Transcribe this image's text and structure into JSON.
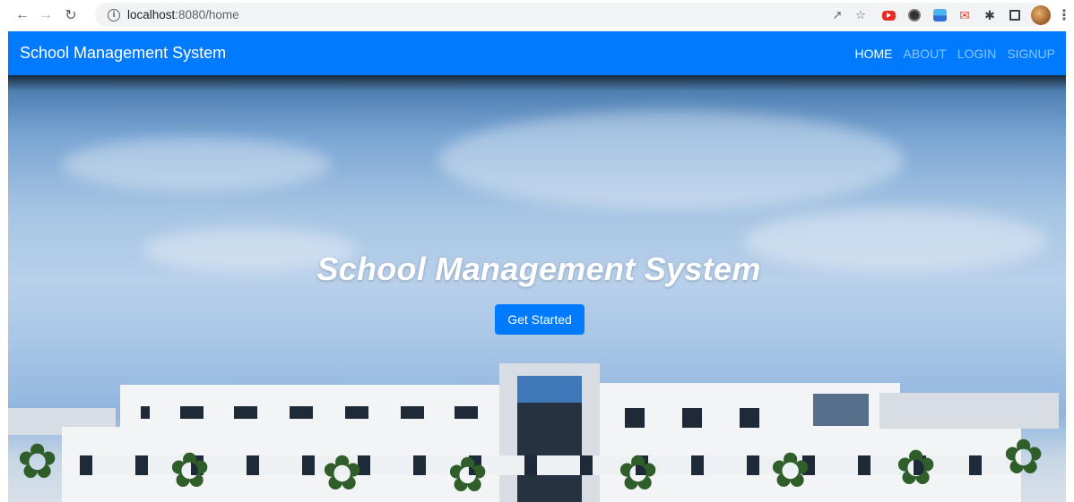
{
  "browser": {
    "url_host": "localhost",
    "url_rest": ":8080/home",
    "icons": [
      "back-arrow-icon",
      "forward-arrow-icon",
      "reload-icon",
      "info-icon",
      "share-icon",
      "star-icon",
      "youtube-extension-icon",
      "circle-extension-icon",
      "drive-extension-icon",
      "megaphone-extension-icon",
      "puzzle-extension-icon",
      "side-panel-icon",
      "profile-avatar",
      "menu-kebab-icon"
    ]
  },
  "navbar": {
    "brand": "School Management System",
    "links": [
      {
        "label": "HOME",
        "active": true
      },
      {
        "label": "ABOUT",
        "active": false
      },
      {
        "label": "LOGIN",
        "active": false
      },
      {
        "label": "SIGNUP",
        "active": false
      }
    ]
  },
  "hero": {
    "title": "School Management System",
    "button_label": "Get Started"
  },
  "colors": {
    "primary": "#007bff",
    "nav_text_inactive": "rgba(255,255,255,0.55)"
  }
}
